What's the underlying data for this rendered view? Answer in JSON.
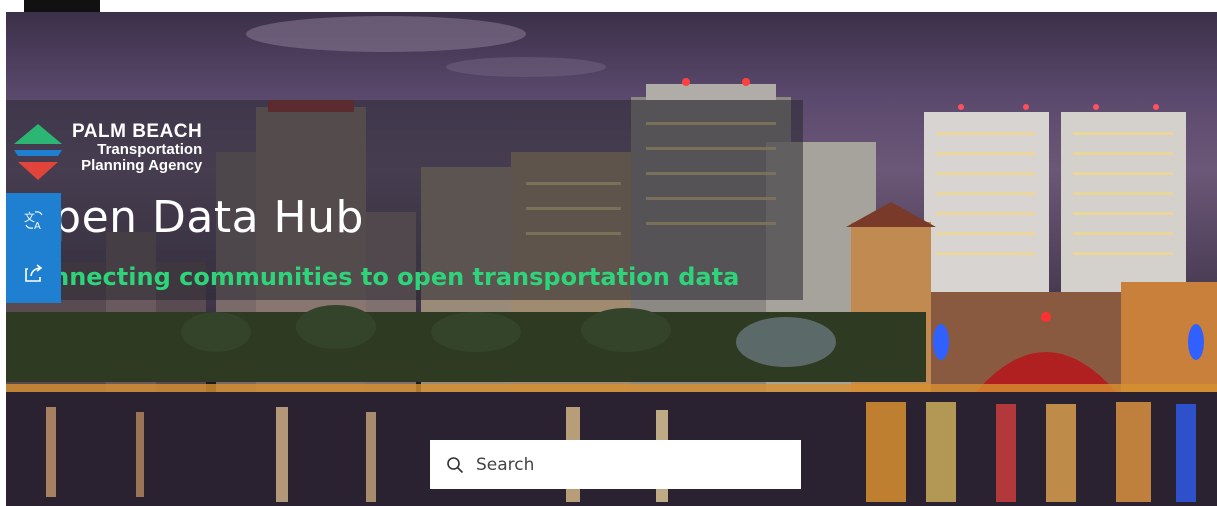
{
  "branding": {
    "logo_line1": "PALM BEACH",
    "logo_line2": "Transportation",
    "logo_line3": "Planning Agency",
    "logo_colors": [
      "#2bb673",
      "#1f7fd1",
      "#e0443a"
    ]
  },
  "hero": {
    "title": "Open Data Hub",
    "subtitle": "Connecting communities to open transportation data",
    "subtitle_color": "#2ed47a",
    "background_icon": "city-skyline-night-photo"
  },
  "toolbar": {
    "color": "#1f7fd1",
    "buttons": [
      {
        "icon": "translate-icon",
        "label": "Translate"
      },
      {
        "icon": "share-icon",
        "label": "Share"
      }
    ]
  },
  "search": {
    "placeholder": "Search",
    "value": "",
    "icon": "search-icon"
  }
}
